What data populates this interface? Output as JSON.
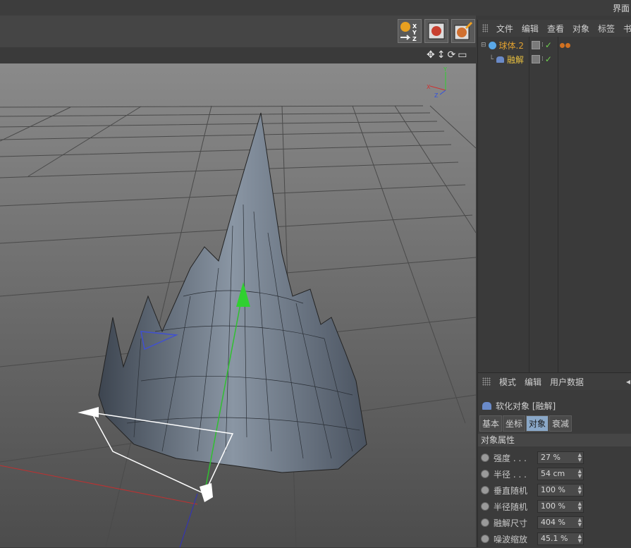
{
  "window": {
    "title_right": "界面"
  },
  "panel_menu": [
    "文件",
    "编辑",
    "查看",
    "对象",
    "标签",
    "书"
  ],
  "objects": [
    {
      "name": "球体.2",
      "color": "#e0a030"
    },
    {
      "name": "融解",
      "color": "#e8c040"
    }
  ],
  "attr_menu": [
    "模式",
    "编辑",
    "用户数据"
  ],
  "attr_title": "软化对象 [融解]",
  "tabs": [
    "基本",
    "坐标",
    "对象",
    "衰减"
  ],
  "active_tab": "对象",
  "section": "对象属性",
  "props": [
    {
      "label": "强度 . . .",
      "value": "27 %"
    },
    {
      "label": "半径 . . .",
      "value": "54 cm"
    },
    {
      "label": "垂直随机",
      "value": "100 %"
    },
    {
      "label": "半径随机",
      "value": "100 %"
    },
    {
      "label": "融解尺寸",
      "value": "404 %"
    },
    {
      "label": "噪波缩放",
      "value": "45.1 %"
    }
  ],
  "axis_labels": {
    "y": "Y",
    "x": "X",
    "z": "Z"
  },
  "toolbar_icon_text": {
    "axes": "XYZ"
  }
}
